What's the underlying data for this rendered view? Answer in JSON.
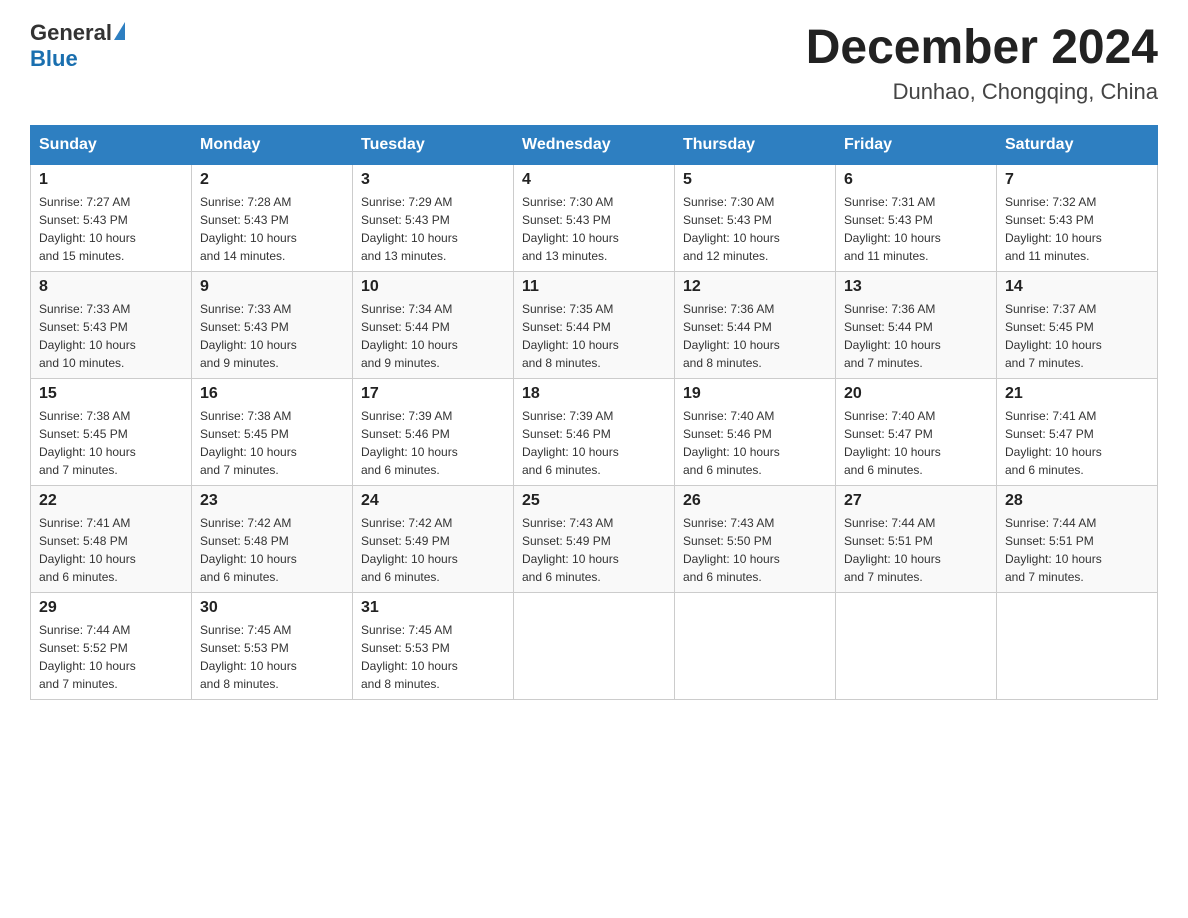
{
  "header": {
    "logo_general": "General",
    "logo_blue": "Blue",
    "title": "December 2024",
    "subtitle": "Dunhao, Chongqing, China"
  },
  "days_of_week": [
    "Sunday",
    "Monday",
    "Tuesday",
    "Wednesday",
    "Thursday",
    "Friday",
    "Saturday"
  ],
  "weeks": [
    [
      {
        "day": "1",
        "sunrise": "7:27 AM",
        "sunset": "5:43 PM",
        "daylight": "10 hours and 15 minutes."
      },
      {
        "day": "2",
        "sunrise": "7:28 AM",
        "sunset": "5:43 PM",
        "daylight": "10 hours and 14 minutes."
      },
      {
        "day": "3",
        "sunrise": "7:29 AM",
        "sunset": "5:43 PM",
        "daylight": "10 hours and 13 minutes."
      },
      {
        "day": "4",
        "sunrise": "7:30 AM",
        "sunset": "5:43 PM",
        "daylight": "10 hours and 13 minutes."
      },
      {
        "day": "5",
        "sunrise": "7:30 AM",
        "sunset": "5:43 PM",
        "daylight": "10 hours and 12 minutes."
      },
      {
        "day": "6",
        "sunrise": "7:31 AM",
        "sunset": "5:43 PM",
        "daylight": "10 hours and 11 minutes."
      },
      {
        "day": "7",
        "sunrise": "7:32 AM",
        "sunset": "5:43 PM",
        "daylight": "10 hours and 11 minutes."
      }
    ],
    [
      {
        "day": "8",
        "sunrise": "7:33 AM",
        "sunset": "5:43 PM",
        "daylight": "10 hours and 10 minutes."
      },
      {
        "day": "9",
        "sunrise": "7:33 AM",
        "sunset": "5:43 PM",
        "daylight": "10 hours and 9 minutes."
      },
      {
        "day": "10",
        "sunrise": "7:34 AM",
        "sunset": "5:44 PM",
        "daylight": "10 hours and 9 minutes."
      },
      {
        "day": "11",
        "sunrise": "7:35 AM",
        "sunset": "5:44 PM",
        "daylight": "10 hours and 8 minutes."
      },
      {
        "day": "12",
        "sunrise": "7:36 AM",
        "sunset": "5:44 PM",
        "daylight": "10 hours and 8 minutes."
      },
      {
        "day": "13",
        "sunrise": "7:36 AM",
        "sunset": "5:44 PM",
        "daylight": "10 hours and 7 minutes."
      },
      {
        "day": "14",
        "sunrise": "7:37 AM",
        "sunset": "5:45 PM",
        "daylight": "10 hours and 7 minutes."
      }
    ],
    [
      {
        "day": "15",
        "sunrise": "7:38 AM",
        "sunset": "5:45 PM",
        "daylight": "10 hours and 7 minutes."
      },
      {
        "day": "16",
        "sunrise": "7:38 AM",
        "sunset": "5:45 PM",
        "daylight": "10 hours and 7 minutes."
      },
      {
        "day": "17",
        "sunrise": "7:39 AM",
        "sunset": "5:46 PM",
        "daylight": "10 hours and 6 minutes."
      },
      {
        "day": "18",
        "sunrise": "7:39 AM",
        "sunset": "5:46 PM",
        "daylight": "10 hours and 6 minutes."
      },
      {
        "day": "19",
        "sunrise": "7:40 AM",
        "sunset": "5:46 PM",
        "daylight": "10 hours and 6 minutes."
      },
      {
        "day": "20",
        "sunrise": "7:40 AM",
        "sunset": "5:47 PM",
        "daylight": "10 hours and 6 minutes."
      },
      {
        "day": "21",
        "sunrise": "7:41 AM",
        "sunset": "5:47 PM",
        "daylight": "10 hours and 6 minutes."
      }
    ],
    [
      {
        "day": "22",
        "sunrise": "7:41 AM",
        "sunset": "5:48 PM",
        "daylight": "10 hours and 6 minutes."
      },
      {
        "day": "23",
        "sunrise": "7:42 AM",
        "sunset": "5:48 PM",
        "daylight": "10 hours and 6 minutes."
      },
      {
        "day": "24",
        "sunrise": "7:42 AM",
        "sunset": "5:49 PM",
        "daylight": "10 hours and 6 minutes."
      },
      {
        "day": "25",
        "sunrise": "7:43 AM",
        "sunset": "5:49 PM",
        "daylight": "10 hours and 6 minutes."
      },
      {
        "day": "26",
        "sunrise": "7:43 AM",
        "sunset": "5:50 PM",
        "daylight": "10 hours and 6 minutes."
      },
      {
        "day": "27",
        "sunrise": "7:44 AM",
        "sunset": "5:51 PM",
        "daylight": "10 hours and 7 minutes."
      },
      {
        "day": "28",
        "sunrise": "7:44 AM",
        "sunset": "5:51 PM",
        "daylight": "10 hours and 7 minutes."
      }
    ],
    [
      {
        "day": "29",
        "sunrise": "7:44 AM",
        "sunset": "5:52 PM",
        "daylight": "10 hours and 7 minutes."
      },
      {
        "day": "30",
        "sunrise": "7:45 AM",
        "sunset": "5:53 PM",
        "daylight": "10 hours and 8 minutes."
      },
      {
        "day": "31",
        "sunrise": "7:45 AM",
        "sunset": "5:53 PM",
        "daylight": "10 hours and 8 minutes."
      },
      null,
      null,
      null,
      null
    ]
  ],
  "labels": {
    "sunrise": "Sunrise:",
    "sunset": "Sunset:",
    "daylight": "Daylight:"
  }
}
